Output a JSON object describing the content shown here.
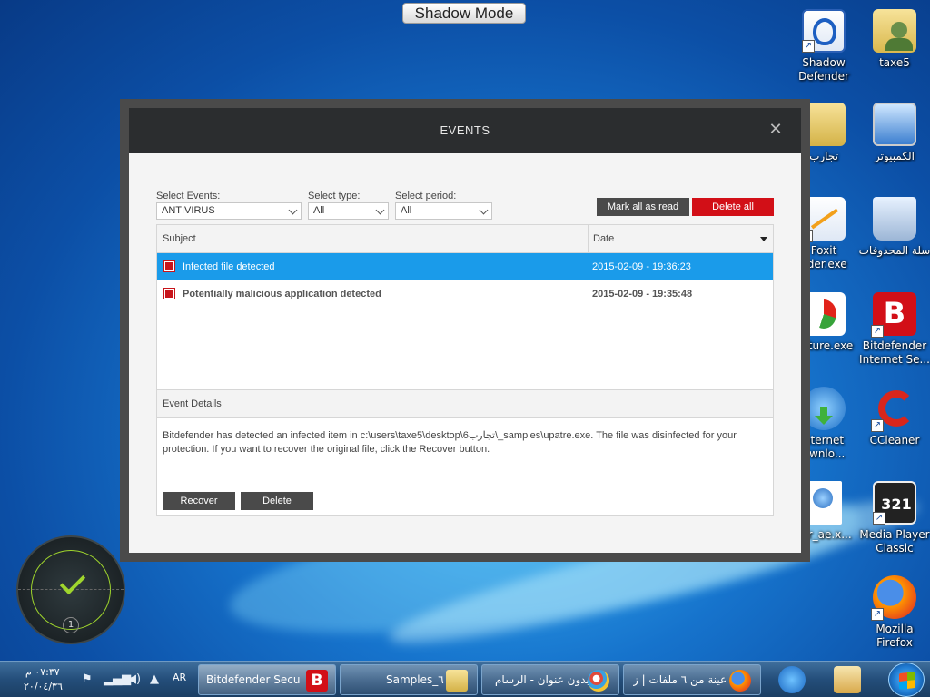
{
  "desktop": {
    "shadow_mode_label": "Shadow Mode",
    "icons": [
      {
        "label": "Shadow Defender",
        "icon": "shield-icon"
      },
      {
        "label": "taxe5",
        "icon": "user-folder-icon"
      },
      {
        "label": "تجارب",
        "icon": "folder-icon"
      },
      {
        "label": "الكمبيوتر",
        "icon": "computer-icon"
      },
      {
        "label": "Foxit\nader.exe",
        "icon": "pdf-reader-icon"
      },
      {
        "label": "سلة المحذوفات",
        "icon": "recycle-bin-icon"
      },
      {
        "label": "apture.exe",
        "icon": "chart-icon"
      },
      {
        "label": "Bitdefender Internet Se...",
        "icon": "bitdefender-icon"
      },
      {
        "label": "nternet\nownlo...",
        "icon": "download-manager-icon"
      },
      {
        "label": "CCleaner",
        "icon": "ccleaner-icon"
      },
      {
        "label": "_ar_ae.x...",
        "icon": "document-icon"
      },
      {
        "label": "Media Player Classic",
        "icon": "media-player-icon"
      },
      {
        "label": "Mozilla Firefox",
        "icon": "firefox-icon"
      }
    ]
  },
  "dialog": {
    "title": "EVENTS",
    "filters": {
      "events_label": "Select Events:",
      "events_value": "ANTIVIRUS",
      "type_label": "Select type:",
      "type_value": "All",
      "period_label": "Select period:",
      "period_value": "All"
    },
    "actions": {
      "mark_all_read": "Mark all as read",
      "delete_all": "Delete all"
    },
    "table": {
      "col_subject": "Subject",
      "col_date": "Date",
      "rows": [
        {
          "subject": "Infected file detected",
          "date": "2015-02-09 - 19:36:23"
        },
        {
          "subject": "Potentially malicious application detected",
          "date": "2015-02-09 - 19:35:48"
        }
      ]
    },
    "details": {
      "title": "Event Details",
      "text": "Bitdefender has detected an infected item in c:\\users\\taxe5\\desktop\\6تجارب\\_samples\\upatre.exe. The file was disinfected for your protection. If you want to recover the original file, click the Recover button.",
      "recover": "Recover",
      "delete": "Delete"
    }
  },
  "gadget": {
    "count": "1"
  },
  "taskbar": {
    "clock_time": "٠٧:٣٧ م",
    "clock_date": "٢٠/٠٤/٣٦",
    "lang": "AR",
    "tasks": [
      {
        "label": "Bitdefender Secu...",
        "icon": "bitdefender-icon"
      },
      {
        "label": "Samples_٦",
        "icon": "folder-icon"
      },
      {
        "label": "بدون عنوان - الرسام",
        "icon": "paint-icon"
      },
      {
        "label": "عينة من ٦ ملفات | ز...",
        "icon": "firefox-icon"
      }
    ]
  },
  "colors": {
    "accent": "#1a9bea",
    "danger": "#d20f17",
    "header": "#2b2d2f"
  }
}
